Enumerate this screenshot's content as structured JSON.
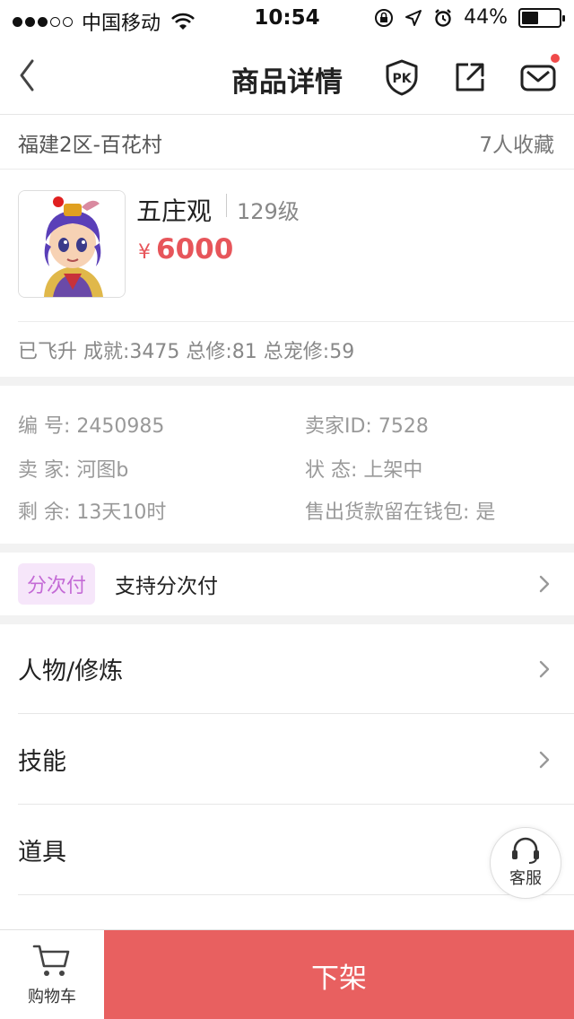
{
  "status_bar": {
    "carrier": "中国移动",
    "time": "10:54",
    "battery_percent": "44%",
    "battery_level": 0.44
  },
  "nav": {
    "title": "商品详情"
  },
  "listing": {
    "server": "福建2区-百花村",
    "favorites": "7人收藏",
    "name": "五庄观",
    "level": "129级",
    "currency": "¥",
    "price": "6000",
    "stats": "已飞升 成就:3475 总修:81 总宠修:59"
  },
  "info": {
    "id_label": "编 号:",
    "id_value": "2450985",
    "seller_id_label": "卖家ID:",
    "seller_id_value": "7528",
    "seller_label": "卖 家:",
    "seller_value": "河图b",
    "status_label": "状 态:",
    "status_value": "上架中",
    "remaining_label": "剩 余:",
    "remaining_value": "13天10时",
    "wallet_label": "售出货款留在钱包:",
    "wallet_value": "是"
  },
  "installment": {
    "tag": "分次付",
    "text": "支持分次付"
  },
  "menu": {
    "items": [
      "人物/修炼",
      "技能",
      "道具"
    ]
  },
  "service": {
    "label": "客服"
  },
  "bottom": {
    "cart_label": "购物车",
    "action_label": "下架"
  },
  "colors": {
    "price": "#e7555a",
    "action_bg": "#e86060",
    "tag_bg": "#f6e6fa",
    "tag_text": "#c46bd6"
  }
}
